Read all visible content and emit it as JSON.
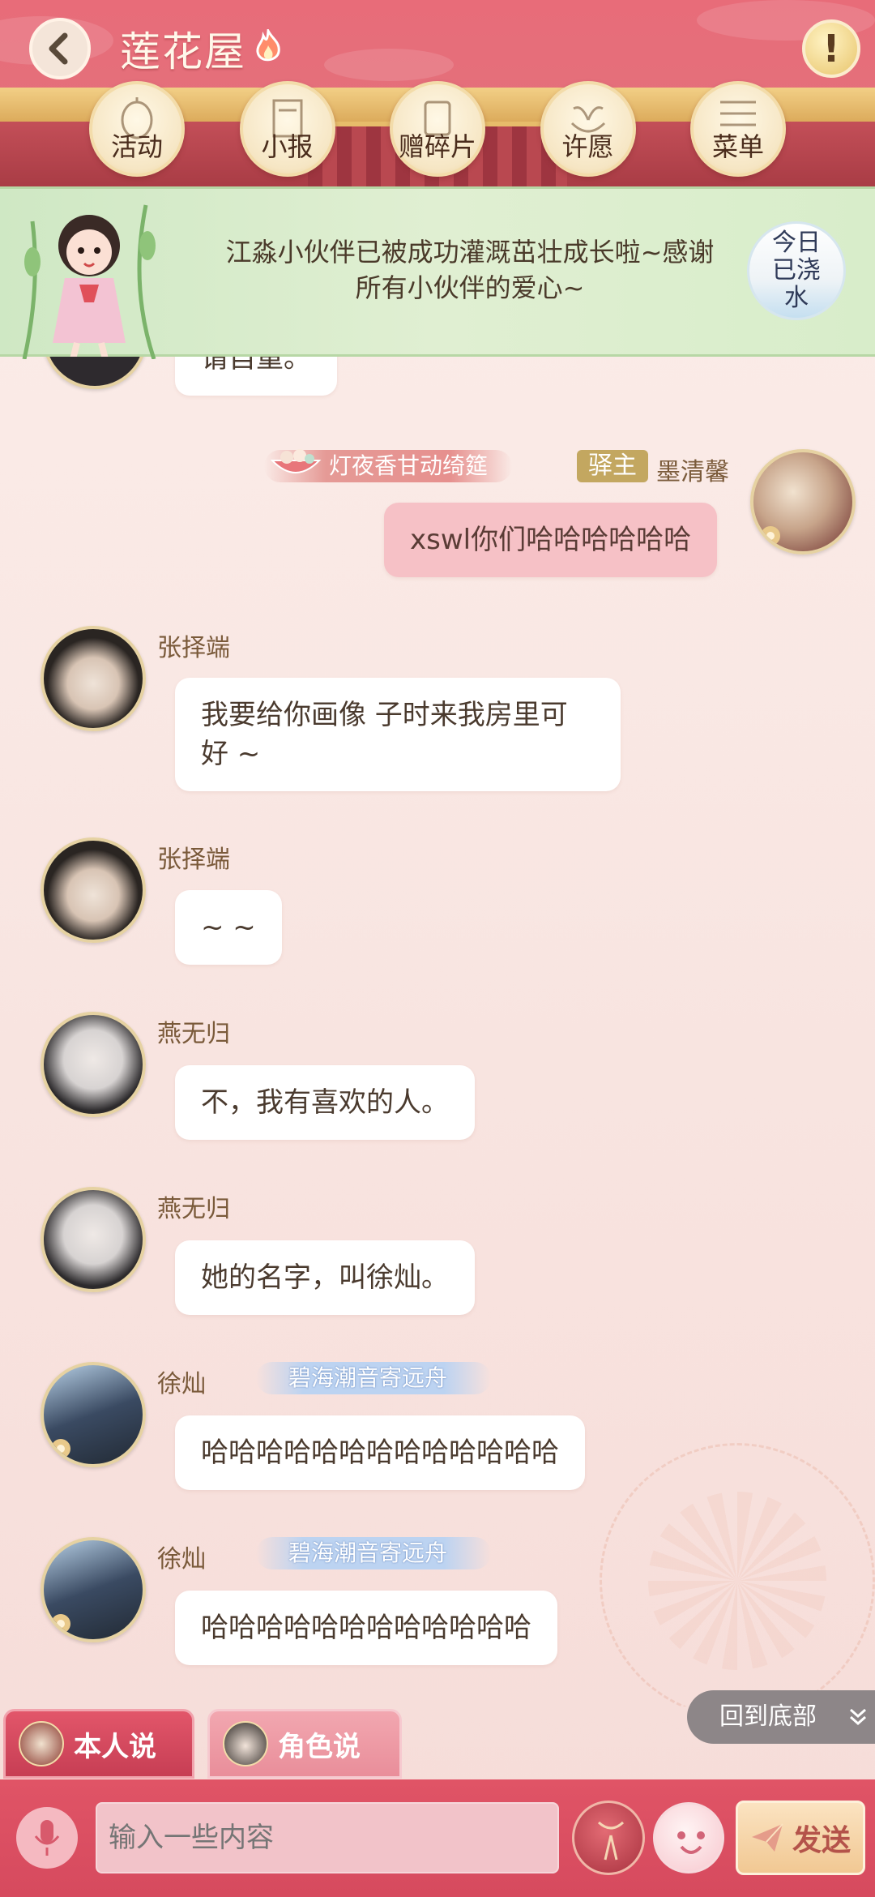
{
  "header": {
    "title": "莲花屋",
    "nav": [
      {
        "label": "活动",
        "icon": "lantern-icon"
      },
      {
        "label": "小报",
        "icon": "scroll-icon"
      },
      {
        "label": "赠碎片",
        "icon": "card-icon"
      },
      {
        "label": "许愿",
        "icon": "fountain-icon"
      },
      {
        "label": "菜单",
        "icon": "menu-icon"
      }
    ]
  },
  "banner": {
    "text_line1": "江淼小伙伴已被成功灌溉茁壮成长啦~感谢",
    "text_line2": "所有小伙伴的爱心~",
    "water_button": "今日已浇水"
  },
  "messages": [
    {
      "id": "partial",
      "text": "请自重。"
    },
    {
      "id": "me",
      "sender": "墨清馨",
      "badge": "驿主",
      "title_tag": "灯夜香甘动绮筵",
      "text": "xswl你们哈哈哈哈哈哈"
    },
    {
      "id": "m1",
      "sender": "张择端",
      "text": "我要给你画像 子时来我房里可好 ~"
    },
    {
      "id": "m2",
      "sender": "张择端",
      "text": "~ ~"
    },
    {
      "id": "m3",
      "sender": "燕无归",
      "text": "不，我有喜欢的人。"
    },
    {
      "id": "m4",
      "sender": "燕无归",
      "text": "她的名字，叫徐灿。"
    },
    {
      "id": "m5",
      "sender": "徐灿",
      "title_tag": "碧海潮音寄远舟",
      "text": "哈哈哈哈哈哈哈哈哈哈哈哈哈"
    },
    {
      "id": "m6",
      "sender": "徐灿",
      "title_tag": "碧海潮音寄远舟",
      "text": "哈哈哈哈哈哈哈哈哈哈哈哈"
    }
  ],
  "controls": {
    "back_to_bottom": "回到底部",
    "tab_self": "本人说",
    "tab_role": "角色说",
    "input_placeholder": "输入一些内容",
    "send": "发送"
  },
  "colors": {
    "header": "#e4707b",
    "banner": "#d8edca",
    "bubble_me": "#f6c1c6",
    "input_bar": "#d64a5e",
    "send_button": "#f1c893"
  }
}
